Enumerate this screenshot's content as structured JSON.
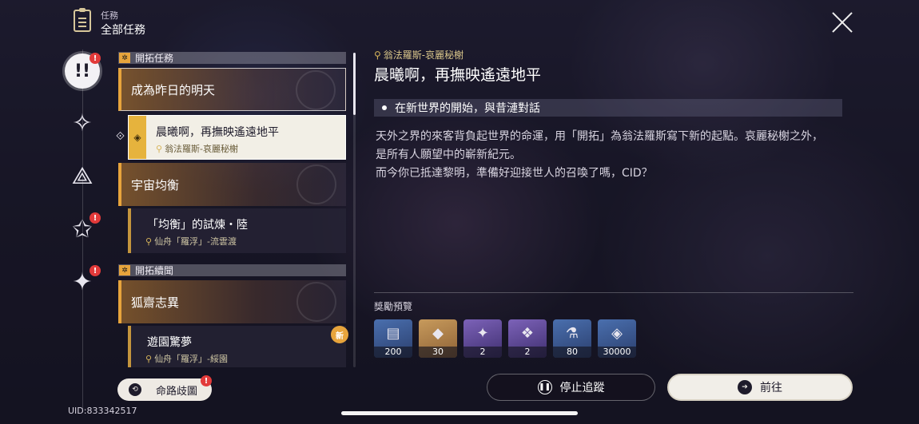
{
  "header": {
    "subtitle": "任務",
    "title": "全部任務"
  },
  "rail": {
    "items": [
      {
        "name": "all",
        "glyph": "!!",
        "badge": "!"
      },
      {
        "name": "trailblaze",
        "glyph": "✧",
        "badge": ""
      },
      {
        "name": "companion",
        "glyph": "⟁",
        "badge": ""
      },
      {
        "name": "adventure",
        "glyph": "✩",
        "badge": "!"
      },
      {
        "name": "daily",
        "glyph": "✦",
        "badge": "!"
      }
    ]
  },
  "categories": {
    "trailblaze_mission": "開拓任務",
    "trailblaze_continuance": "開拓續聞"
  },
  "list": {
    "group1": "成為昨日的明天",
    "quest1_title": "晨曦啊，再撫映遙遠地平",
    "quest1_location": "翁法羅斯-哀麗秘榭",
    "group2": "宇宙均衡",
    "quest2_title": "「均衡」的試煉・陸",
    "quest2_location": "仙舟「羅浮」-流雲渡",
    "group3": "狐齋志異",
    "quest3_title": "遊園驚夢",
    "quest3_location": "仙舟「羅浮」-綏園",
    "new_badge": "新"
  },
  "detail": {
    "location": "翁法羅斯-哀麗秘榭",
    "title": "晨曦啊，再撫映遙遠地平",
    "objective": "在新世界的開始，與昔漣對話",
    "desc_line1": "天外之界的來客背負起世界的命運，用「開拓」為翁法羅斯寫下新的起點。哀麗秘榭之外，",
    "desc_line2": "是所有人願望中的嶄新紀元。",
    "desc_line3": "而今你已抵達黎明，準備好迎接世人的召喚了嗎，CID？"
  },
  "rewards": {
    "label": "獎勵預覽",
    "items": [
      {
        "icon": "book-icon",
        "count": "200"
      },
      {
        "icon": "crystal-icon",
        "count": "30"
      },
      {
        "icon": "relic-icon",
        "count": "2"
      },
      {
        "icon": "material-icon",
        "count": "2"
      },
      {
        "icon": "exp-potion-icon",
        "count": "80"
      },
      {
        "icon": "credit-icon",
        "count": "30000"
      }
    ]
  },
  "buttons": {
    "stop_tracking": "停止追蹤",
    "go": "前往",
    "path": "命路歧圖"
  },
  "footer": {
    "uid": "UID:833342517"
  },
  "colors": {
    "accent": "#e7a43c",
    "badge": "#e23a3a",
    "location": "#d8c58a"
  }
}
